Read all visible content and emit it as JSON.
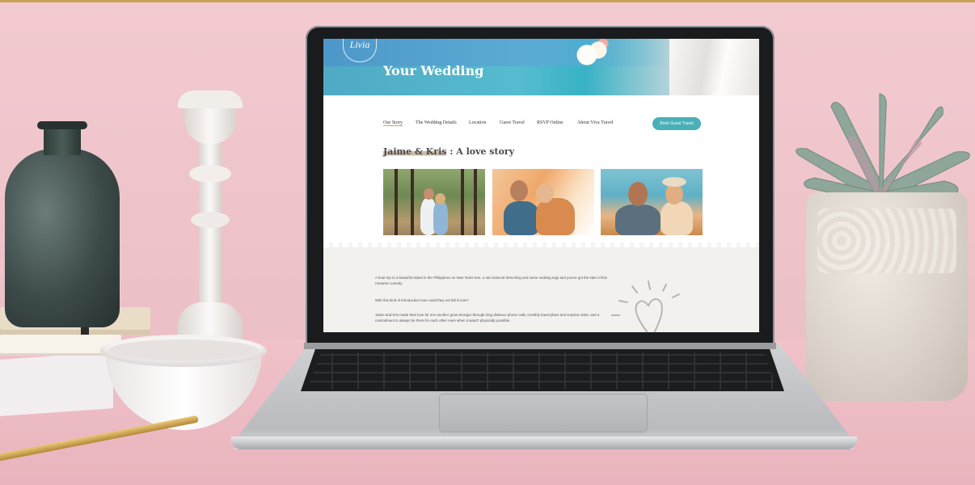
{
  "website": {
    "logo_text": "Livia",
    "hero_title": "Your Wedding",
    "nav": {
      "items": [
        {
          "label": "Our Story",
          "active": true
        },
        {
          "label": "The Wedding Details",
          "active": false
        },
        {
          "label": "Location",
          "active": false
        },
        {
          "label": "Guest Travel",
          "active": false
        },
        {
          "label": "RSVP Online",
          "active": false
        },
        {
          "label": "About Viva Travel",
          "active": false
        }
      ],
      "cta_label": "Book Guest Travel"
    },
    "story": {
      "names": "Jaime & Kris",
      "title_rest": ": A love story"
    },
    "paragraphs": [
      "A boat trip to a beautiful island in the Philippines on New Years Eve, a rain induced drenching and some soaking togs and you've got the start of this romantic comedy.",
      "With this kind of introduction how could they not fall in love?",
      "Jaime and Kris made their love for one another grow stronger through long distance phone calls, monthly travel plans and surprise visits, and a commitment to always be there for each other even when it wasn't physically possible."
    ]
  },
  "colors": {
    "wall": "#f2cbd1",
    "accent_teal": "#4ab0b8",
    "nav_underline": "#c8a86a"
  }
}
